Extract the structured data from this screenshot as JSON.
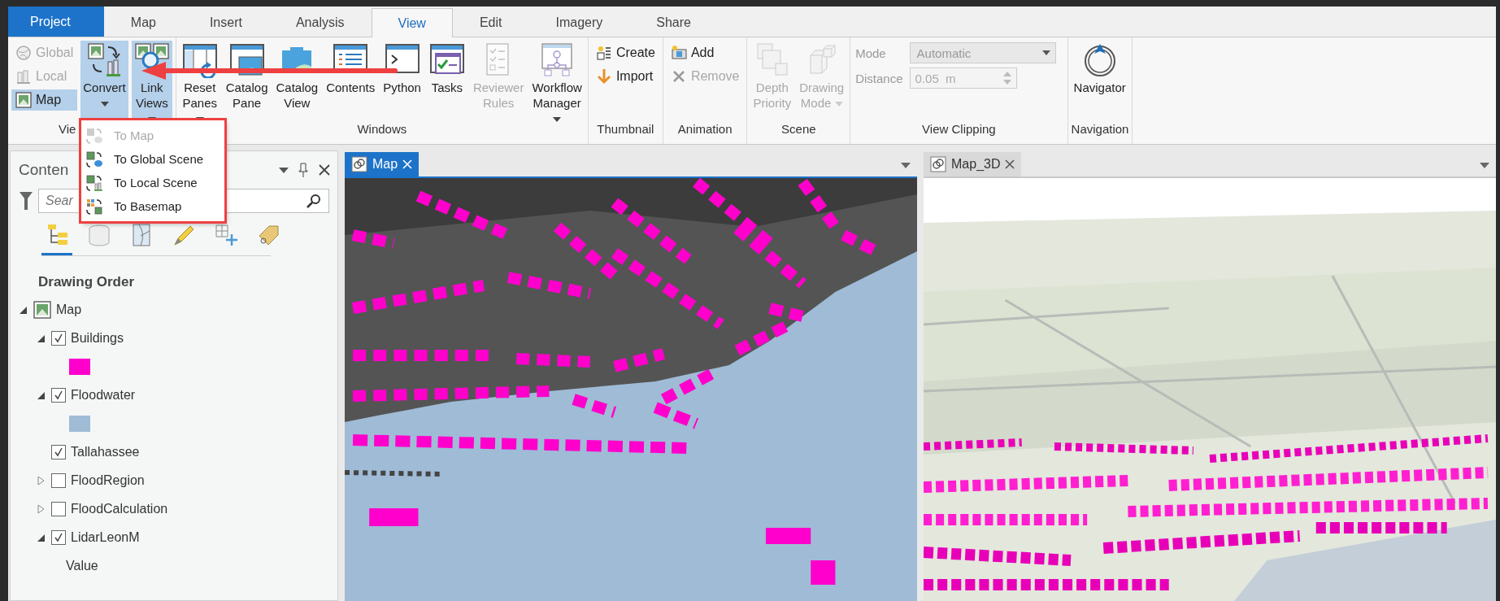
{
  "tabs": [
    {
      "label": "Project",
      "kind": "backstage",
      "selected": false
    },
    {
      "label": "Map",
      "kind": "tab",
      "selected": false
    },
    {
      "label": "Insert",
      "kind": "tab",
      "selected": false
    },
    {
      "label": "Analysis",
      "kind": "tab",
      "selected": false
    },
    {
      "label": "View",
      "kind": "tab",
      "selected": true
    },
    {
      "label": "Edit",
      "kind": "tab",
      "selected": false
    },
    {
      "label": "Imagery",
      "kind": "tab",
      "selected": false
    },
    {
      "label": "Share",
      "kind": "tab",
      "selected": false
    }
  ],
  "ribbon": {
    "groups": [
      {
        "label": "Vie",
        "items": [
          {
            "kind": "stack",
            "buttons": [
              {
                "label": "Global",
                "disabled": true,
                "selected": false
              },
              {
                "label": "Local",
                "disabled": true,
                "selected": false
              },
              {
                "label": "Map",
                "disabled": false,
                "selected": true
              }
            ]
          },
          {
            "kind": "large",
            "label": "Convert",
            "menu": true,
            "pressed": true,
            "disabled": false
          },
          {
            "kind": "large",
            "label": "Link Views",
            "menu": true,
            "pressed": true,
            "disabled": false
          }
        ]
      },
      {
        "label": "Windows",
        "items": [
          {
            "kind": "large",
            "label": "Reset Panes",
            "menu": true,
            "pressed": false,
            "disabled": false
          },
          {
            "kind": "large",
            "label": "Catalog Pane",
            "menu": false,
            "pressed": false,
            "disabled": false
          },
          {
            "kind": "large",
            "label": "Catalog View",
            "menu": false,
            "pressed": false,
            "disabled": false
          },
          {
            "kind": "large",
            "label": "Contents",
            "menu": false,
            "pressed": false,
            "disabled": false
          },
          {
            "kind": "large",
            "label": "Python",
            "menu": false,
            "pressed": false,
            "disabled": false
          },
          {
            "kind": "large",
            "label": "Tasks",
            "menu": false,
            "pressed": false,
            "disabled": false
          },
          {
            "kind": "large",
            "label": "Reviewer Rules",
            "menu": false,
            "pressed": false,
            "disabled": true
          },
          {
            "kind": "large",
            "label": "Workflow Manager",
            "menu": true,
            "pressed": false,
            "disabled": false
          }
        ]
      },
      {
        "label": "Thumbnail",
        "items": [
          {
            "kind": "stack",
            "buttons": [
              {
                "label": "Create",
                "disabled": false,
                "selected": false
              },
              {
                "label": "Import",
                "disabled": false,
                "selected": false
              }
            ]
          }
        ]
      },
      {
        "label": "Animation",
        "items": [
          {
            "kind": "stack",
            "buttons": [
              {
                "label": "Add",
                "disabled": false,
                "selected": false
              },
              {
                "label": "Remove",
                "disabled": true,
                "selected": false
              }
            ]
          }
        ]
      },
      {
        "label": "Scene",
        "items": [
          {
            "kind": "large",
            "label": "Depth Priority",
            "menu": false,
            "pressed": false,
            "disabled": true
          },
          {
            "kind": "large",
            "label": "Drawing Mode",
            "menu": true,
            "pressed": false,
            "disabled": true
          }
        ]
      },
      {
        "label": "View Clipping",
        "items": [
          {
            "kind": "fields",
            "fields": [
              {
                "label": "Mode",
                "value": "Automatic",
                "kind": "combo",
                "disabled": true
              },
              {
                "label": "Distance",
                "value": "0.05  m",
                "kind": "spin",
                "disabled": true
              }
            ]
          }
        ]
      },
      {
        "label": "Navigation",
        "items": [
          {
            "kind": "large",
            "label": "Navigator",
            "menu": false,
            "pressed": false,
            "disabled": false
          }
        ]
      }
    ]
  },
  "convert_menu": {
    "callout_box": true,
    "callout_arrow": true,
    "items": [
      {
        "label": "To Map",
        "disabled": true
      },
      {
        "label": "To Global Scene",
        "disabled": false
      },
      {
        "label": "To Local Scene",
        "disabled": false
      },
      {
        "label": "To Basemap",
        "disabled": false
      }
    ]
  },
  "contents": {
    "title": "Conten",
    "search_placeholder": "Sear",
    "tabs": [
      {
        "selected": true
      },
      {
        "selected": false
      },
      {
        "selected": false
      },
      {
        "selected": false
      },
      {
        "selected": false
      },
      {
        "selected": false
      }
    ],
    "section": "Drawing Order",
    "tree": [
      {
        "kind": "map",
        "label": "Map",
        "expanded": true,
        "children": [
          {
            "kind": "layer",
            "label": "Buildings",
            "checked": true,
            "expanded": true,
            "children": [
              {
                "kind": "swatch",
                "color": "#ff00cc"
              }
            ]
          },
          {
            "kind": "layer",
            "label": "Floodwater",
            "checked": true,
            "expanded": true,
            "children": [
              {
                "kind": "swatch",
                "color": "#9fbbd6"
              }
            ]
          },
          {
            "kind": "layer",
            "label": "Tallahassee",
            "checked": true
          },
          {
            "kind": "layer",
            "label": "FloodRegion",
            "checked": false,
            "expanded": false
          },
          {
            "kind": "layer",
            "label": "FloodCalculation",
            "checked": false,
            "expanded": false
          },
          {
            "kind": "layer",
            "label": "LidarLeonM",
            "checked": true,
            "expanded": true,
            "children": [
              {
                "kind": "text",
                "label": "Value"
              }
            ]
          }
        ]
      }
    ]
  },
  "views": [
    {
      "title": "Map",
      "active": true,
      "kind": "map2d"
    },
    {
      "title": "Map_3D",
      "active": false,
      "kind": "scene3d"
    }
  ]
}
